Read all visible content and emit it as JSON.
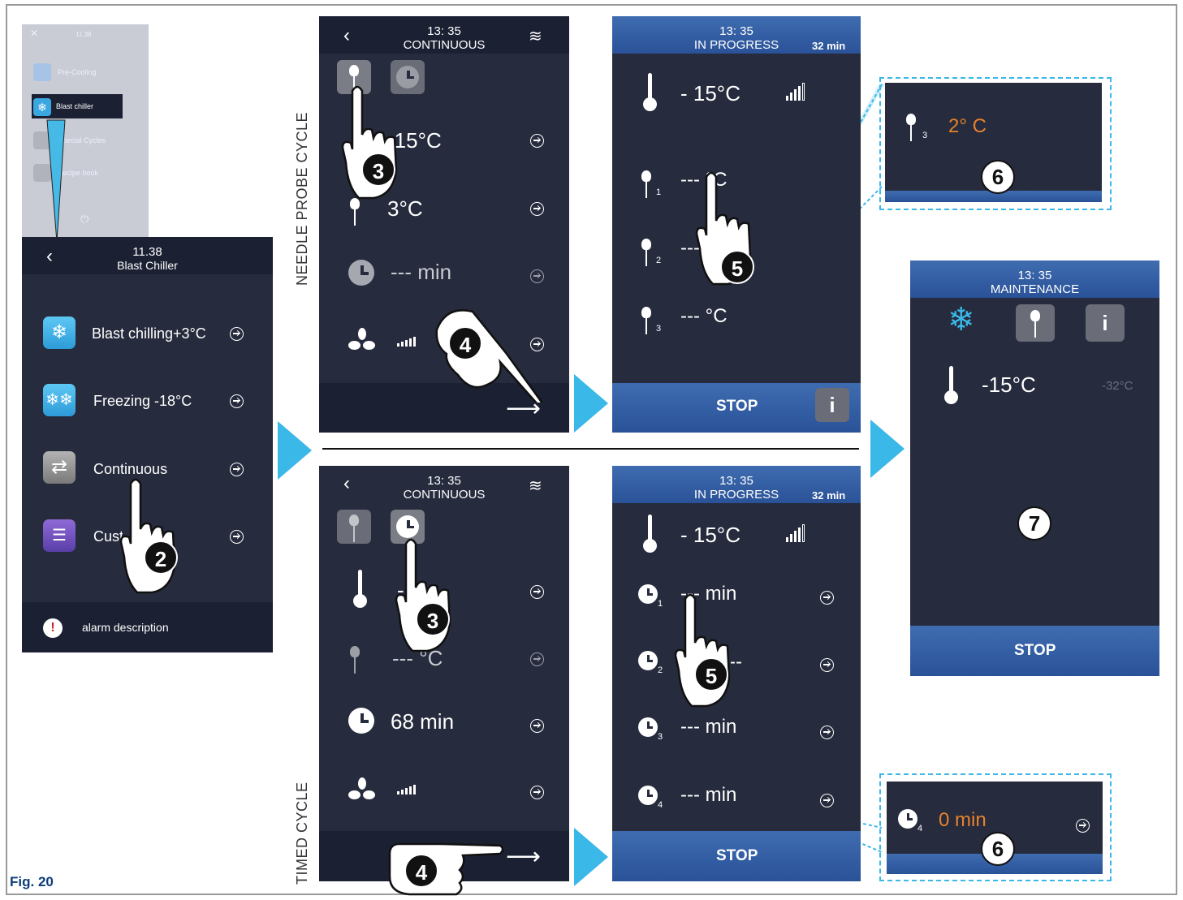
{
  "figure_label": "Fig. 20",
  "labels": {
    "needle": "NEEDLE PROBE CYCLE",
    "timed": "TIMED CYCLE"
  },
  "thumb": {
    "time": "11.38",
    "items": [
      "Pre-Cooling",
      "Blast chiller",
      "Special Cycles",
      "Recipe book"
    ]
  },
  "menu": {
    "time": "11.38",
    "title": "Blast Chiller",
    "items": [
      "Blast chilling+3°C",
      "Freezing -18°C",
      "Continuous",
      "Customisation"
    ],
    "alarm": "alarm description"
  },
  "needle_setup": {
    "time": "13: 35",
    "title": "CONTINUOUS",
    "rows": [
      "-15°C",
      "3°C",
      "--- min"
    ]
  },
  "needle_progress": {
    "time": "13: 35",
    "title": "IN PROGRESS",
    "duration": "32 min",
    "temp": "- 15°C",
    "probes": [
      "--- °C",
      "--- °C",
      "--- °C"
    ],
    "subs": [
      "1",
      "2",
      "3"
    ],
    "stop": "STOP"
  },
  "zoom1": {
    "value": "2° C",
    "sub": "3"
  },
  "timed_setup": {
    "time": "13: 35",
    "title": "CONTINUOUS",
    "rows": [
      "-15°C",
      "--- °C",
      "68 min"
    ]
  },
  "timed_progress": {
    "time": "13: 35",
    "title": "IN PROGRESS",
    "duration": "32 min",
    "temp": "- 15°C",
    "timers": [
      "--- min",
      "--- min",
      "--- min",
      "--- min"
    ],
    "subs": [
      "1",
      "2",
      "3",
      "4"
    ],
    "stop": "STOP"
  },
  "zoom2": {
    "value": "0 min",
    "sub": "4"
  },
  "maintenance": {
    "time": "13: 35",
    "title": "MAINTENANCE",
    "temp": "-15°C",
    "target": "-32°C",
    "stop": "STOP",
    "info": "i"
  },
  "steps": {
    "s2": "2",
    "s3": "3",
    "s4": "4",
    "s5": "5",
    "s6": "6",
    "s7": "7"
  },
  "colors": {
    "screen": "#262b3d",
    "header_blue": "#2a5298",
    "accent": "#3ab8e8",
    "highlight": "#e8822a"
  }
}
